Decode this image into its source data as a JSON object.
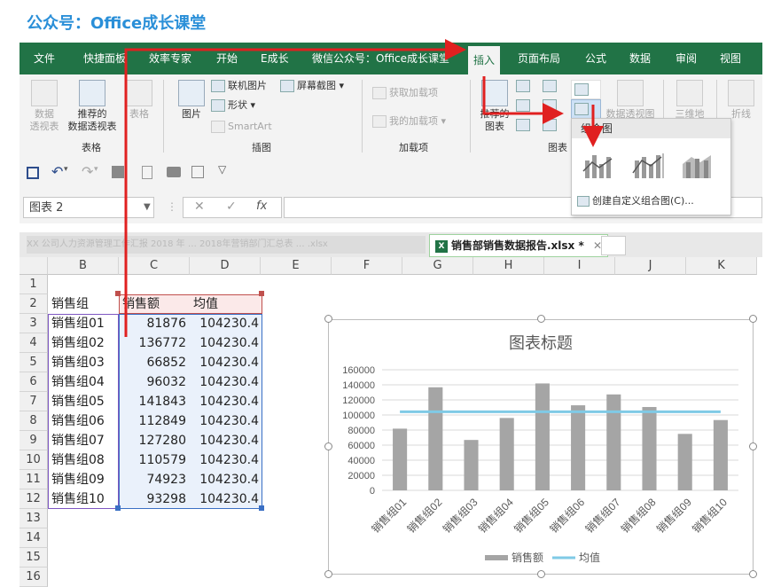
{
  "brand": "公众号：Office成长课堂",
  "ribbon_tabs": [
    "文件",
    "快捷面板",
    "效率专家",
    "开始",
    "E成长",
    "微信公众号：Office成长课堂",
    "插入",
    "页面布局",
    "公式",
    "数据",
    "审阅",
    "视图"
  ],
  "ribbon": {
    "pivot_label1": "数据",
    "pivot_label2": "透视表",
    "rec_pivot_label1": "推荐的",
    "rec_pivot_label2": "数据透视表",
    "table_label": "表格",
    "group_tables": "表格",
    "picture_label": "图片",
    "online_picture": "联机图片",
    "shapes": "形状",
    "smartart": "SmartArt",
    "screenshot": "屏幕截图",
    "group_illustrations": "插图",
    "get_addins": "获取加载项",
    "my_addins": "我的加载项",
    "group_addins": "加载项",
    "rec_chart1": "推荐的",
    "rec_chart2": "图表",
    "pivot_chart": "数据透视图",
    "map3d": "三维地",
    "sparkline": "折线",
    "group_charts": "图表"
  },
  "namebox": "图表 2",
  "files": {
    "blurred": "XX 公司人力资源管理工作汇报 2018 年 … 2018年营销部门汇总表 … .xlsx",
    "active": "销售部销售数据报告.xlsx *",
    "close": "✕"
  },
  "columns": [
    "B",
    "C",
    "D",
    "E",
    "F",
    "G",
    "H",
    "I",
    "J",
    "K"
  ],
  "rows": [
    "1",
    "2",
    "3",
    "4",
    "5",
    "6",
    "7",
    "8",
    "9",
    "10",
    "11",
    "12",
    "13",
    "14",
    "15",
    "16"
  ],
  "table": {
    "headers": [
      "销售组",
      "销售额",
      "均值"
    ],
    "data": [
      [
        "销售组01",
        "81876",
        "104230.4"
      ],
      [
        "销售组02",
        "136772",
        "104230.4"
      ],
      [
        "销售组03",
        "66852",
        "104230.4"
      ],
      [
        "销售组04",
        "96032",
        "104230.4"
      ],
      [
        "销售组05",
        "141843",
        "104230.4"
      ],
      [
        "销售组06",
        "112849",
        "104230.4"
      ],
      [
        "销售组07",
        "127280",
        "104230.4"
      ],
      [
        "销售组08",
        "110579",
        "104230.4"
      ],
      [
        "销售组09",
        "74923",
        "104230.4"
      ],
      [
        "销售组10",
        "93298",
        "104230.4"
      ]
    ]
  },
  "dropdown": {
    "title": "组合图",
    "custom": "创建自定义组合图(C)..."
  },
  "chart_data": {
    "type": "bar",
    "title": "图表标题",
    "categories": [
      "销售组01",
      "销售组02",
      "销售组03",
      "销售组04",
      "销售组05",
      "销售组06",
      "销售组07",
      "销售组08",
      "销售组09",
      "销售组10"
    ],
    "series": [
      {
        "name": "销售额",
        "type": "bar",
        "color": "#a5a5a5",
        "values": [
          81876,
          136772,
          66852,
          96032,
          141843,
          112849,
          127280,
          110579,
          74923,
          93298
        ]
      },
      {
        "name": "均值",
        "type": "line",
        "color": "#7fcae6",
        "values": [
          104230.4,
          104230.4,
          104230.4,
          104230.4,
          104230.4,
          104230.4,
          104230.4,
          104230.4,
          104230.4,
          104230.4
        ]
      }
    ],
    "yticks": [
      "0",
      "20000",
      "40000",
      "60000",
      "80000",
      "100000",
      "120000",
      "140000",
      "160000"
    ],
    "ylim": [
      0,
      160000
    ],
    "grid": true,
    "legend": "bottom"
  },
  "colors": {
    "excel_green": "#217346",
    "annotation_red": "#e02020",
    "bar": "#a5a5a5",
    "line": "#7fcae6"
  }
}
